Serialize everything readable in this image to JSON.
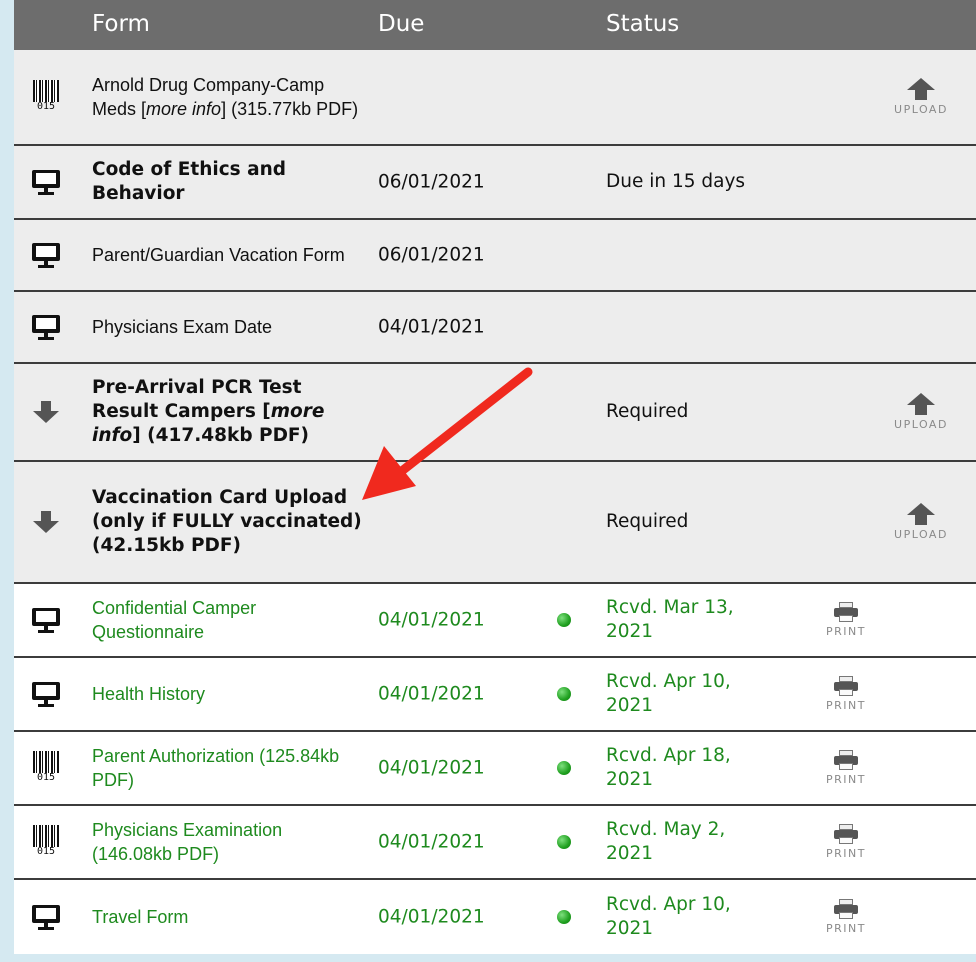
{
  "columns": {
    "form": "Form",
    "due": "Due",
    "status": "Status"
  },
  "rows": [
    {
      "icon": "barcode-icon",
      "icon_text": "015",
      "name": "Arnold Drug Company-Camp Meds [",
      "name_italic": "more info",
      "name_tail": "] (315.77kb PDF)",
      "due": "",
      "status": "",
      "action": "UPLOAD"
    },
    {
      "icon": "monitor-icon",
      "name": "Code of Ethics and Behavior",
      "due": "06/01/2021",
      "status": "Due in 15 days"
    },
    {
      "icon": "monitor-icon",
      "name": "Parent/Guardian Vacation Form",
      "due": "06/01/2021",
      "status": ""
    },
    {
      "icon": "monitor-icon",
      "name": "Physicians Exam Date",
      "due": "04/01/2021",
      "status": ""
    },
    {
      "icon": "download-icon",
      "name": "Pre-Arrival PCR Test Result Campers [",
      "name_italic": "more info",
      "name_tail": "] (417.48kb PDF)",
      "due": "",
      "status": "Required",
      "action": "UPLOAD"
    },
    {
      "icon": "download-icon",
      "name": "Vaccination Card Upload (only if FULLY vaccinated) (42.15kb PDF)",
      "due": "",
      "status": "Required",
      "action": "UPLOAD"
    },
    {
      "icon": "monitor-icon",
      "name": "Confidential Camper Questionnaire",
      "due": "04/01/2021",
      "status": "Rcvd. Mar 13, 2021",
      "action": "PRINT"
    },
    {
      "icon": "monitor-icon",
      "name": "Health History",
      "due": "04/01/2021",
      "status": "Rcvd. Apr 10, 2021",
      "action": "PRINT"
    },
    {
      "icon": "barcode-icon",
      "icon_text": "015",
      "name": "Parent Authorization (125.84kb PDF)",
      "due": "04/01/2021",
      "status": "Rcvd. Apr 18, 2021",
      "action": "PRINT"
    },
    {
      "icon": "barcode-icon",
      "icon_text": "015",
      "name": "Physicians Examination (146.08kb PDF)",
      "due": "04/01/2021",
      "status": "Rcvd. May 2, 2021",
      "action": "PRINT"
    },
    {
      "icon": "monitor-icon",
      "name": "Travel Form",
      "due": "04/01/2021",
      "status": "Rcvd. Apr 10, 2021",
      "action": "PRINT"
    }
  ],
  "colors": {
    "header_bg": "#6d6d6d",
    "row_gray": "#ededed",
    "received_green": "#1e8a1e",
    "annotation_red": "#f0291e",
    "page_bg": "#d5e9f1"
  }
}
